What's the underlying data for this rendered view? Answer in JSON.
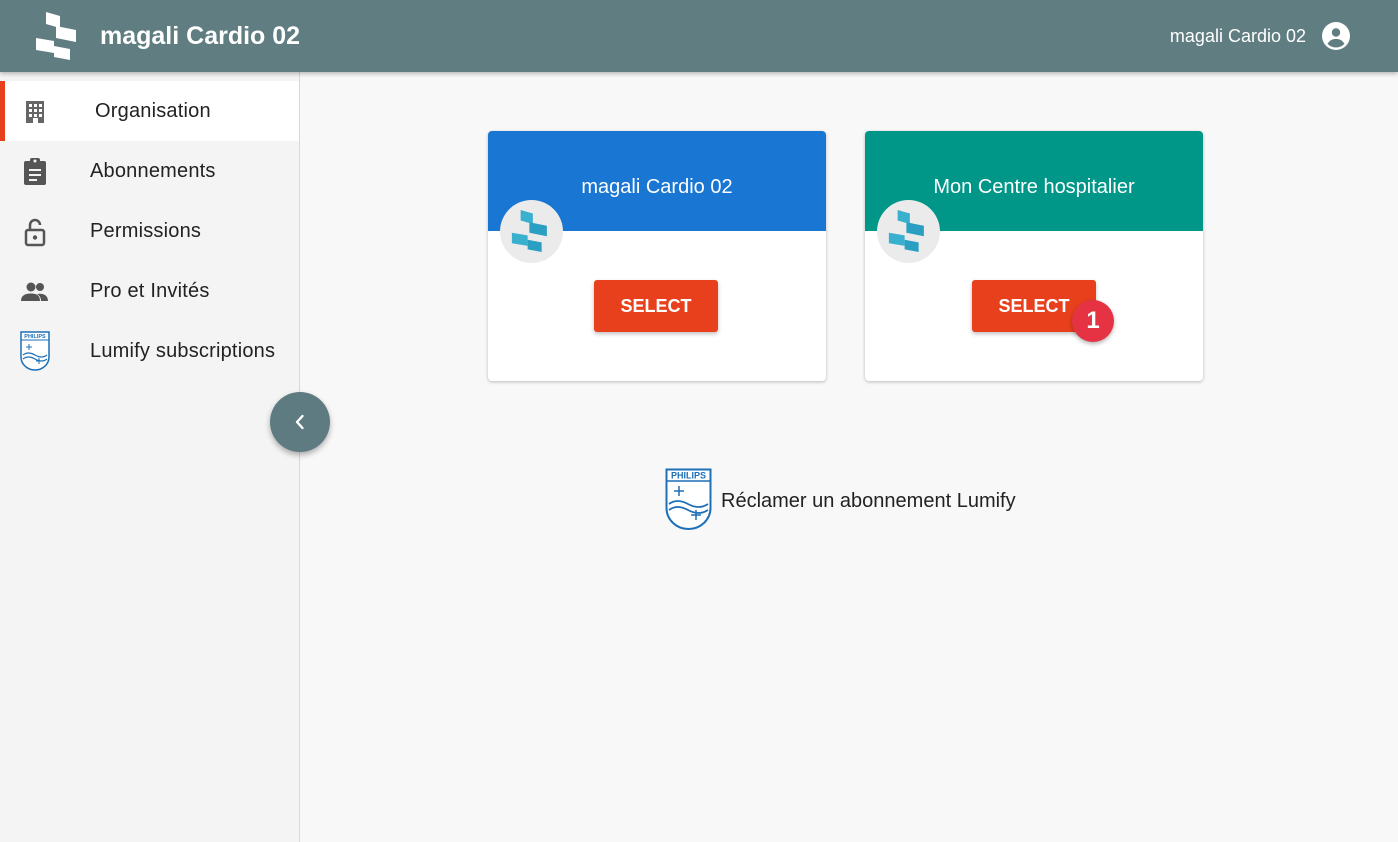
{
  "header": {
    "app_title": "magali Cardio 02",
    "user_name": "magali Cardio 02",
    "background_color": "#607d82",
    "logo_icon": "app-logo-icon",
    "account_icon": "account-circle-icon"
  },
  "sidebar": {
    "items": [
      {
        "label": "Organisation",
        "icon": "building-icon",
        "active": true
      },
      {
        "label": "Abonnements",
        "icon": "clipboard-icon",
        "active": false
      },
      {
        "label": "Permissions",
        "icon": "unlock-icon",
        "active": false
      },
      {
        "label": "Pro et Invités",
        "icon": "people-icon",
        "active": false
      },
      {
        "label": "Lumify subscriptions",
        "icon": "philips-shield-icon",
        "active": false
      }
    ],
    "active_color": "#e8401c",
    "collapse_icon": "chevron-left-icon"
  },
  "cards": [
    {
      "title": "magali Cardio 02",
      "header_color": "#1976d2",
      "button_label": "SELECT"
    },
    {
      "title": "Mon Centre hospitalier",
      "header_color": "#009688",
      "button_label": "SELECT"
    }
  ],
  "badge": {
    "value": "1",
    "color": "#e63343"
  },
  "claim": {
    "label": "Réclamer un abonnement Lumify",
    "logo_text": "PHILIPS",
    "icon": "philips-shield-icon"
  },
  "accent_color": "#e8401c"
}
